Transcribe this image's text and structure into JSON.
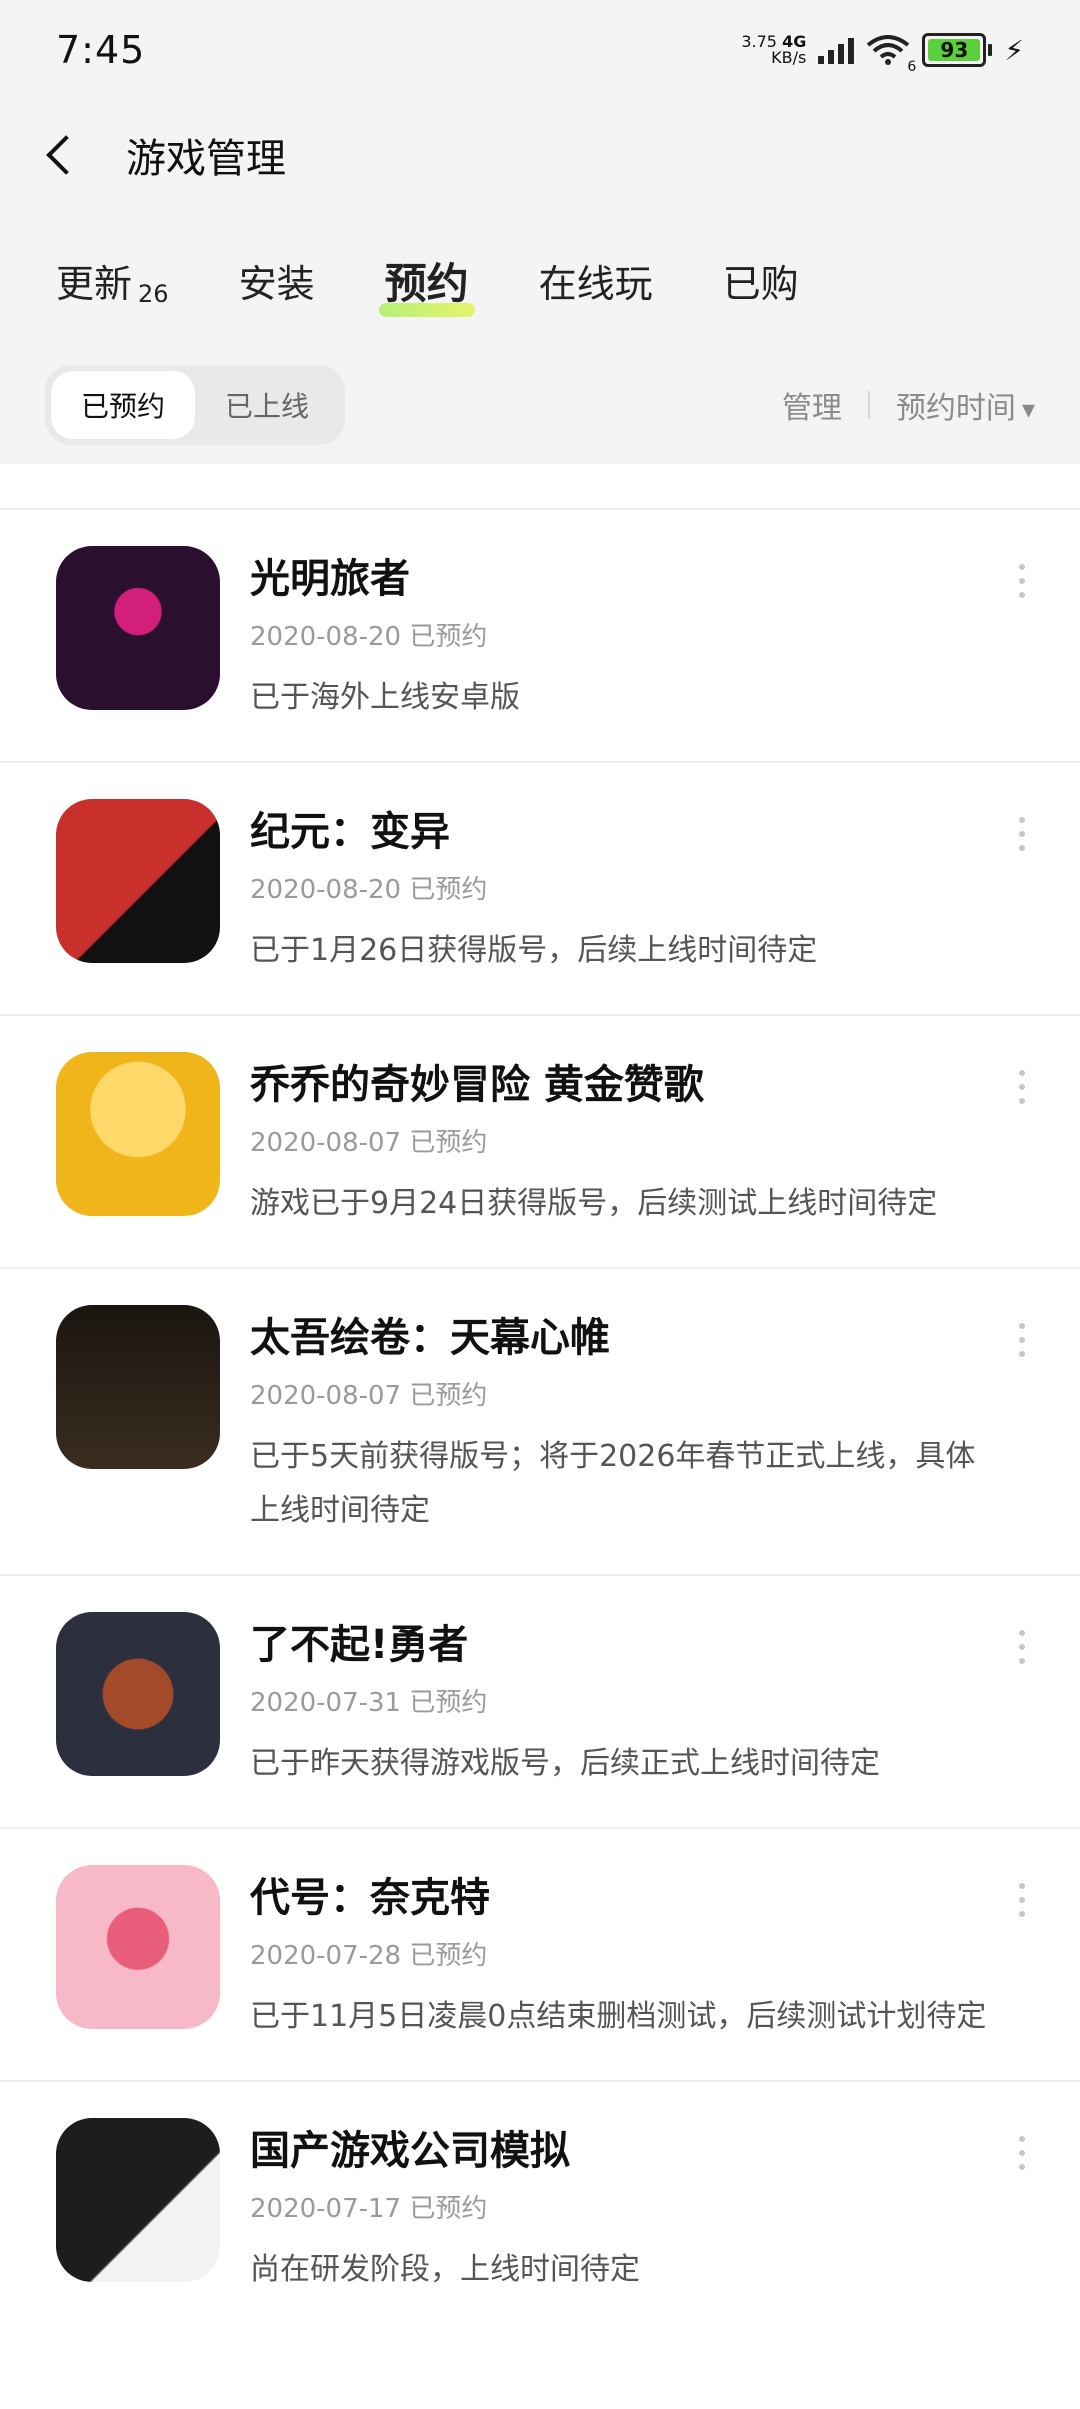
{
  "status": {
    "time": "7:45",
    "net_speed_value": "3.75",
    "net_speed_unit": "KB/s",
    "net_type": "4G",
    "wifi_level": "6",
    "battery": "93"
  },
  "header": {
    "title": "游戏管理"
  },
  "tabs": [
    {
      "label": "更新",
      "badge": "26"
    },
    {
      "label": "安装"
    },
    {
      "label": "预约"
    },
    {
      "label": "在线玩"
    },
    {
      "label": "已购"
    }
  ],
  "filter": {
    "segments": [
      "已预约",
      "已上线"
    ],
    "manage": "管理",
    "sort": "预约时间"
  },
  "games": [
    {
      "name": "光明旅者",
      "date": "2020-08-20 已预约",
      "desc": "已于海外上线安卓版",
      "colors": [
        "#2a0f2e",
        "#d21f7a"
      ]
    },
    {
      "name": "纪元：变异",
      "date": "2020-08-20 已预约",
      "desc": "已于1月26日获得版号，后续上线时间待定",
      "colors": [
        "#c9302c",
        "#111111"
      ]
    },
    {
      "name": "乔乔的奇妙冒险 黄金赞歌",
      "date": "2020-08-07 已预约",
      "desc": "游戏已于9月24日获得版号，后续测试上线时间待定",
      "colors": [
        "#f1b51c",
        "#ffd86a"
      ]
    },
    {
      "name": "太吾绘卷：天幕心帷",
      "date": "2020-08-07 已预约",
      "desc": "已于5天前获得版号；将于2026年春节正式上线，具体上线时间待定",
      "colors": [
        "#1a1510",
        "#3a2d1f"
      ]
    },
    {
      "name": "了不起!勇者",
      "date": "2020-07-31 已预约",
      "desc": "已于昨天获得游戏版号，后续正式上线时间待定",
      "colors": [
        "#2b2f3e",
        "#a34a2a"
      ]
    },
    {
      "name": "代号：奈克特",
      "date": "2020-07-28 已预约",
      "desc": "已于11月5日凌晨0点结束删档测试，后续测试计划待定",
      "colors": [
        "#f7b8c7",
        "#e85d7a"
      ]
    },
    {
      "name": "国产游戏公司模拟",
      "date": "2020-07-17 已预约",
      "desc": "尚在研发阶段，上线时间待定",
      "colors": [
        "#1d1d1d",
        "#f3f3f3"
      ]
    }
  ]
}
